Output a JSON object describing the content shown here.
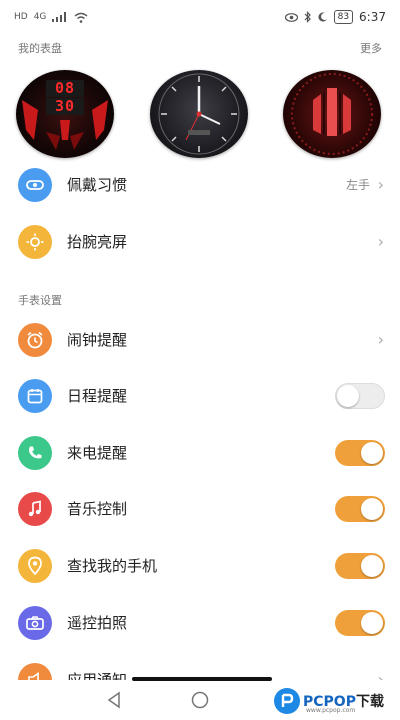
{
  "status_bar": {
    "signal_left_1": "HD",
    "signal_left_2": "4G",
    "battery": "83",
    "time": "6:37"
  },
  "faces_section": {
    "title": "我的表盘",
    "more": "更多"
  },
  "face1": {
    "time_top": "08",
    "time_bottom": "30"
  },
  "watch_settings_title": "手表设置",
  "rows": [
    {
      "label": "佩戴习惯",
      "value": "左手",
      "icon": "wrist-icon",
      "icon_color": "#4a9cf0"
    },
    {
      "label": "抬腕亮屏",
      "icon": "sun-icon",
      "icon_color": "#f4b63a"
    },
    {
      "label": "闹钟提醒",
      "icon": "alarm-icon",
      "icon_color": "#f08a3c"
    },
    {
      "label": "日程提醒",
      "icon": "calendar-icon",
      "icon_color": "#4a9cf0",
      "toggle": false
    },
    {
      "label": "来电提醒",
      "icon": "phone-icon",
      "icon_color": "#3cc88a",
      "toggle": true
    },
    {
      "label": "音乐控制",
      "icon": "music-icon",
      "icon_color": "#e84a4a",
      "toggle": true
    },
    {
      "label": "查找我的手机",
      "icon": "location-icon",
      "icon_color": "#f4b63a",
      "toggle": true
    },
    {
      "label": "遥控拍照",
      "icon": "camera-icon",
      "icon_color": "#6a6ae8",
      "toggle": true
    },
    {
      "label": "应用通知",
      "icon": "notification-icon",
      "icon_color": "#f08a3c"
    }
  ],
  "colors": {
    "accent": "#f0a03a"
  },
  "watermark": {
    "brand": "PCPOP",
    "suffix": "下载",
    "sub": "www.pcpop.com"
  }
}
